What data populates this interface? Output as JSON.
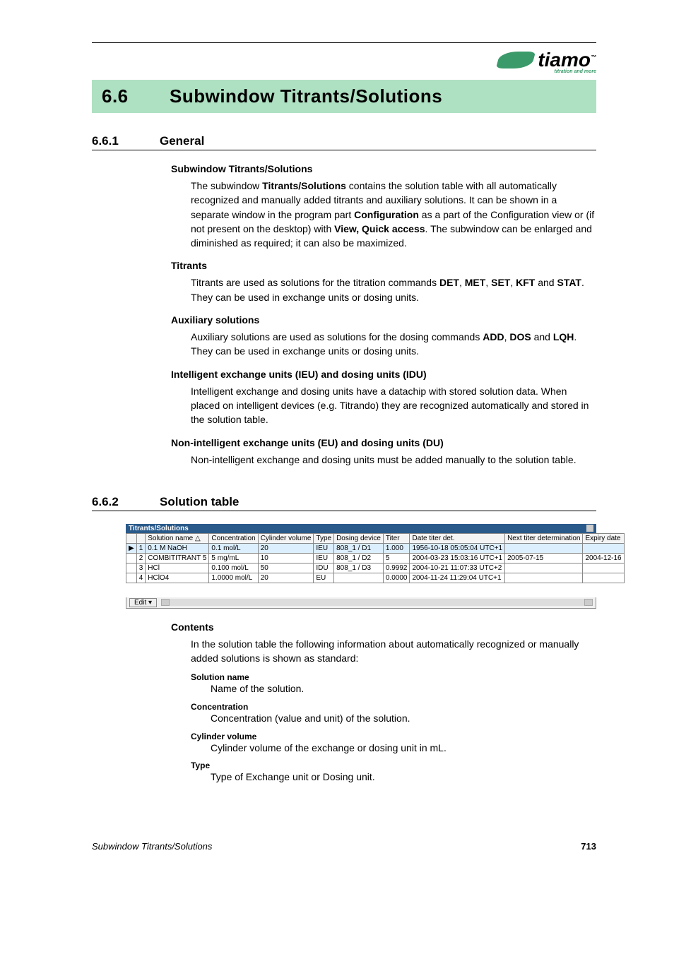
{
  "logo": {
    "brand": "tiamo",
    "tm": "™",
    "tag": "titration and more"
  },
  "section": {
    "num": "6.6",
    "title": "Subwindow Titrants/Solutions"
  },
  "sub1": {
    "num": "6.6.1",
    "title": "General"
  },
  "general": {
    "h_sub": "Subwindow Titrants/Solutions",
    "p_sub_a": "The subwindow ",
    "p_sub_b": "Titrants/Solutions",
    "p_sub_c": " contains the solution table with all automatically recognized and manually added titrants and auxiliary solutions. It can be shown in a separate window in the program part ",
    "p_sub_d": "Configuration",
    "p_sub_e": " as a part of the Configuration view or (if not present on the desktop) with ",
    "p_sub_f": "View, Quick access",
    "p_sub_g": ". The subwindow can be enlarged and diminished as required; it can also be maximized.",
    "h_titr": "Titrants",
    "p_titr_a": "Titrants are used as solutions for the titration commands ",
    "p_titr_b": "DET",
    "p_titr_c": ", ",
    "p_titr_d": "MET",
    "p_titr_e": ", ",
    "p_titr_f": "SET",
    "p_titr_g": ", ",
    "p_titr_h": "KFT",
    "p_titr_i": " and ",
    "p_titr_j": "STAT",
    "p_titr_k": ". They can be used in exchange units or dosing units.",
    "h_aux": "Auxiliary solutions",
    "p_aux_a": "Auxiliary solutions are used as solutions for the dosing commands ",
    "p_aux_b": "ADD",
    "p_aux_c": ", ",
    "p_aux_d": "DOS",
    "p_aux_e": " and ",
    "p_aux_f": "LQH",
    "p_aux_g": ". They can be used in exchange units or dosing units.",
    "h_ieu": "Intelligent exchange units (IEU) and dosing units (IDU)",
    "p_ieu": "Intelligent exchange and dosing units have a datachip with stored solution data. When placed on intelligent devices (e.g. Titrando) they are recognized automatically and stored in the solution table.",
    "h_neu": "Non-intelligent exchange units (EU) and dosing units (DU)",
    "p_neu": "Non-intelligent exchange and dosing units must be added manually to the solution table."
  },
  "sub2": {
    "num": "6.6.2",
    "title": "Solution table"
  },
  "table": {
    "bar_title": "Titrants/Solutions",
    "headers": [
      "",
      "",
      "Solution name △",
      "Concentration",
      "Cylinder volume",
      "Type",
      "Dosing device",
      "Titer",
      "Date titer det.",
      "Next titer determination",
      "Expiry date"
    ],
    "rows": [
      {
        "marker": "▶",
        "n": "1",
        "name": "0.1 M NaOH",
        "conc": "0.1 mol/L",
        "cyl": "20",
        "type": "IEU",
        "dos": "808_1 / D1",
        "titer": "1.000",
        "date": "1956-10-18 05:05:04 UTC+1",
        "next": "",
        "exp": ""
      },
      {
        "marker": "",
        "n": "2",
        "name": "COMBITITRANT 5",
        "conc": "5 mg/mL",
        "cyl": "10",
        "type": "IEU",
        "dos": "808_1 / D2",
        "titer": "5",
        "date": "2004-03-23 15:03:16 UTC+1",
        "next": "2005-07-15",
        "exp": "2004-12-16"
      },
      {
        "marker": "",
        "n": "3",
        "name": "HCl",
        "conc": "0.100 mol/L",
        "cyl": "50",
        "type": "IDU",
        "dos": "808_1 / D3",
        "titer": "0.9992",
        "date": "2004-10-21 11:07:33 UTC+2",
        "next": "",
        "exp": ""
      },
      {
        "marker": "",
        "n": "4",
        "name": "HClO4",
        "conc": "1.0000 mol/L",
        "cyl": "20",
        "type": "EU",
        "dos": "",
        "titer": "0.0000",
        "date": "2004-11-24 11:29:04 UTC+1",
        "next": "",
        "exp": ""
      }
    ],
    "edit": "Edit ▾"
  },
  "contents": {
    "h": "Contents",
    "intro": "In the solution table the following information about automatically recognized or manually added solutions is shown as standard:",
    "defs": [
      {
        "term": "Solution name",
        "text": "Name of the solution."
      },
      {
        "term": "Concentration",
        "text": "Concentration (value and unit) of the solution."
      },
      {
        "term": "Cylinder volume",
        "text": "Cylinder volume of the exchange or dosing unit in mL."
      },
      {
        "term": "Type",
        "text": "Type of Exchange unit or Dosing unit."
      }
    ]
  },
  "footer": {
    "left": "Subwindow Titrants/Solutions",
    "page": "713"
  }
}
